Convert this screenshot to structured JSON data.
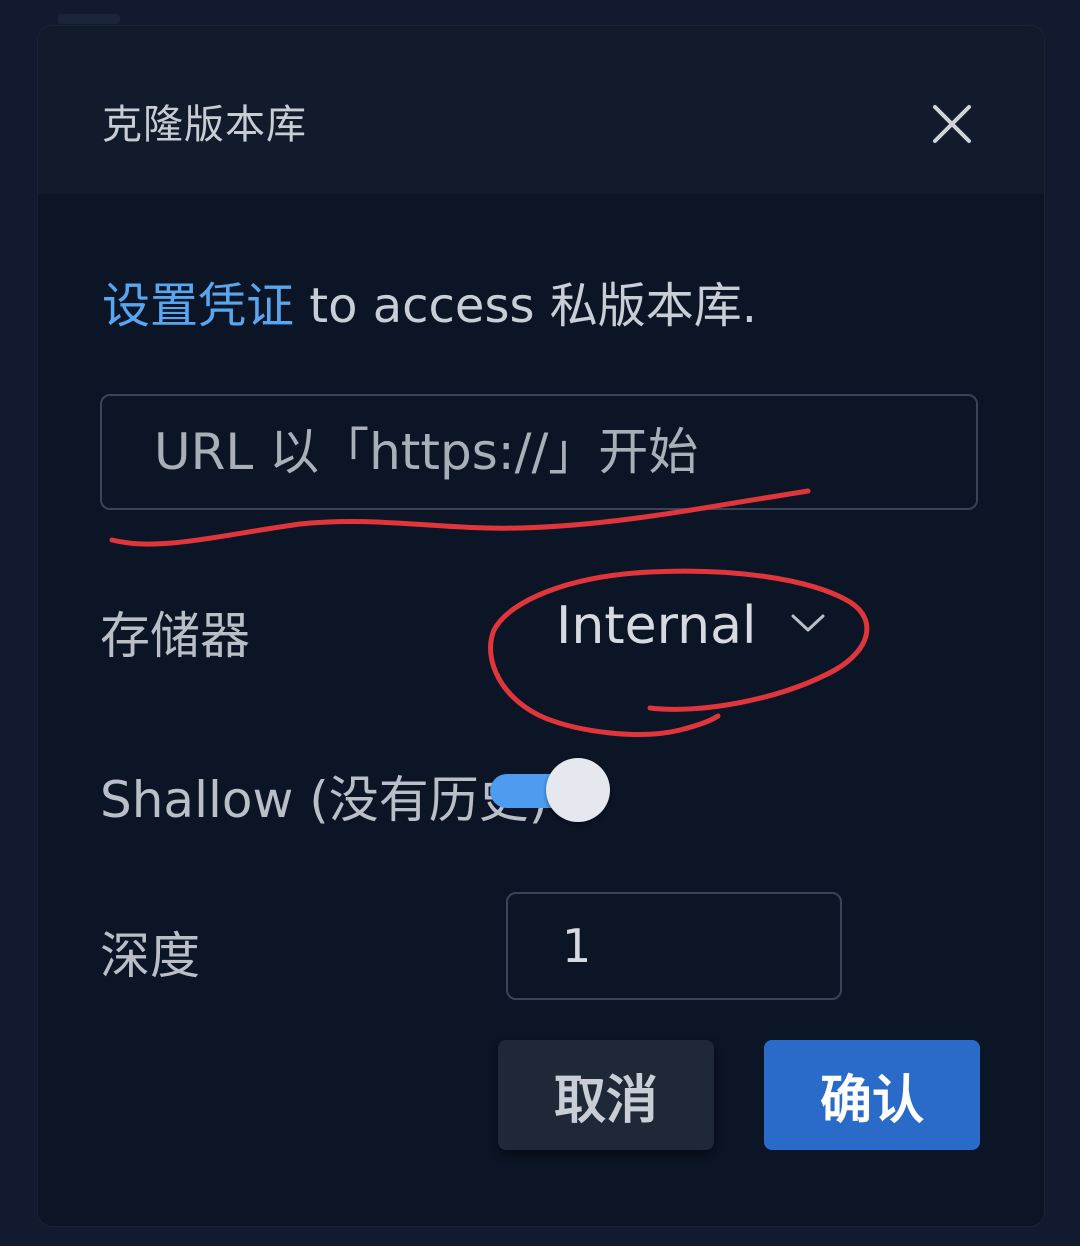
{
  "dialog": {
    "title": "克隆版本库",
    "close_icon": "close-icon"
  },
  "intro": {
    "link_text": "设置凭证",
    "rest_text": " to access 私版本库."
  },
  "url_field": {
    "value": "",
    "placeholder": "URL 以「https://」开始"
  },
  "storage": {
    "label": "存储器",
    "selected": "Internal",
    "icon": "chevron-down-icon"
  },
  "shallow": {
    "label": "Shallow (没有历史)",
    "enabled": true
  },
  "depth": {
    "label": "深度",
    "value": "1"
  },
  "buttons": {
    "cancel": "取消",
    "confirm": "确认"
  },
  "colors": {
    "accent": "#2a6ac9",
    "link": "#58a6f0",
    "toggle_on": "#4d9cf0",
    "annotation": "#e0363b"
  }
}
